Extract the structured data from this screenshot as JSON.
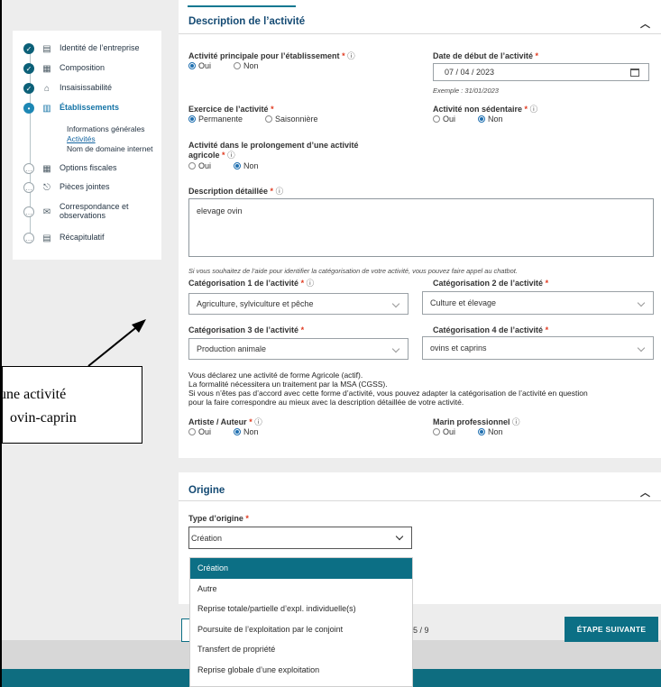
{
  "sidebar": {
    "items": [
      {
        "label": "Identité de l’entreprise",
        "status": "done",
        "icon": "id-card-icon"
      },
      {
        "label": "Composition",
        "status": "done",
        "icon": "list-icon"
      },
      {
        "label": "Insaisissabilité",
        "status": "done",
        "icon": "home-icon"
      },
      {
        "label": "Établissements",
        "status": "current",
        "icon": "building-icon"
      },
      {
        "label": "Options fiscales",
        "status": "todo",
        "icon": "calculator-icon"
      },
      {
        "label": "Pièces jointes",
        "status": "todo",
        "icon": "paperclip-icon"
      },
      {
        "label": "Correspondance et observations",
        "status": "todo",
        "icon": "correspondence-icon"
      },
      {
        "label": "Récapitulatif",
        "status": "todo",
        "icon": "summary-icon"
      }
    ],
    "subitems": [
      "Informations générales",
      "Activités",
      "Nom de domaine internet"
    ],
    "current_subitem": "Activités"
  },
  "description": {
    "title": "Description de l’activité",
    "activite_principale": {
      "label": "Activité principale pour l’établissement",
      "options": [
        "Oui",
        "Non"
      ],
      "selected": "Oui"
    },
    "date_debut": {
      "label": "Date de début de l’activité",
      "value": "07 / 04 / 2023",
      "hint": "Exemple : 31/01/2023"
    },
    "exercice": {
      "label": "Exercice de l’activité",
      "options": [
        "Permanente",
        "Saisonnière"
      ],
      "selected": "Permanente"
    },
    "non_sedentaire": {
      "label": "Activité non sédentaire",
      "options": [
        "Oui",
        "Non"
      ],
      "selected": "Non"
    },
    "prolongement": {
      "label": "Activité dans le prolongement d’une activité",
      "label2": "agricole",
      "options": [
        "Oui",
        "Non"
      ],
      "selected": "Non"
    },
    "description_detaillee": {
      "label": "Description détaillée",
      "value": "elevage ovin"
    },
    "chatbot_hint": "Si vous souhaitez de l’aide pour identifier la catégorisation de votre activité, vous pouvez faire appel au chatbot.",
    "cat1": {
      "label": "Catégorisation 1 de l’activité",
      "value": "Agriculture, sylviculture et pêche"
    },
    "cat2": {
      "label": "Catégorisation 2 de l’activité",
      "value": "Culture et élevage"
    },
    "cat3": {
      "label": "Catégorisation 3 de l’activité",
      "value": "Production animale"
    },
    "cat4": {
      "label": "Catégorisation 4 de l’activité",
      "value": "ovins et caprins"
    },
    "message": [
      "Vous déclarez une activité de forme Agricole (actif).",
      "La formalité nécessitera un traitement par la MSA (CGSS).",
      "Si vous n’êtes pas d’accord avec cette forme d’activité, vous pouvez adapter la catégorisation de l’activité en question",
      "pour la faire correspondre au mieux avec la description détaillée de votre activité."
    ],
    "artiste": {
      "label": "Artiste / Auteur",
      "options": [
        "Oui",
        "Non"
      ],
      "selected": "Non"
    },
    "marin": {
      "label": "Marin professionnel",
      "options": [
        "Oui",
        "Non"
      ],
      "selected": "Non"
    }
  },
  "origine": {
    "title": "Origine",
    "type_label": "Type d’origine",
    "selected": "Création",
    "options": [
      "Création",
      "Autre",
      "Reprise totale/partielle d’expl. individuelle(s)",
      "Poursuite de l’exploitation par le conjoint",
      "Transfert de propriété",
      "Reprise globale d’une exploitation"
    ]
  },
  "navigation": {
    "page_indicator": "5 / 9",
    "next_label": "ÉTAPE SUIVANTE"
  },
  "annotation": {
    "line1": "une activité",
    "line2": "ovin-caprin"
  },
  "colors": {
    "teal": "#0c6f85",
    "title_blue": "#144a73",
    "required": "#e0391f"
  }
}
